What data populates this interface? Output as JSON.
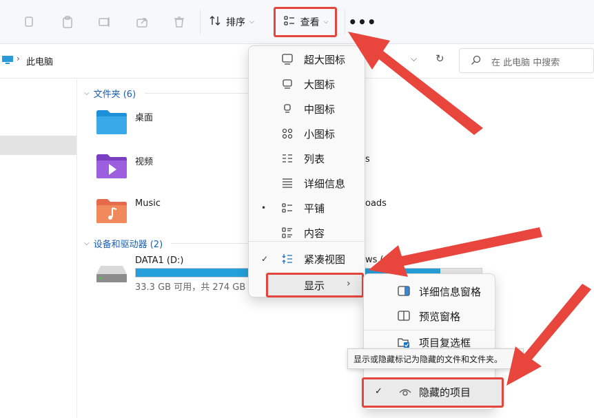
{
  "toolbar": {
    "icons": [
      "copy-icon",
      "paste-icon",
      "rename-icon",
      "share-icon",
      "delete-icon"
    ],
    "sort_label": "排序",
    "view_label": "查看",
    "more_label": "•••"
  },
  "address": {
    "breadcrumb": "此电脑",
    "search_placeholder": "在 此电脑 中搜索"
  },
  "groups": {
    "folders_header": "文件夹 (6)",
    "devices_header": "设备和驱动器 (2)"
  },
  "folders": [
    {
      "label": "桌面"
    },
    {
      "label": "视频"
    },
    {
      "label": "Music"
    }
  ],
  "peek": {
    "p1": "s",
    "p2": "oads",
    "p3": "ws (C"
  },
  "drive": {
    "name": "DATA1 (D:)",
    "info": "33.3 GB 可用，共 274 GB",
    "used_fraction": 0.88
  },
  "view_menu": {
    "items": [
      {
        "label": "超大图标",
        "mark": ""
      },
      {
        "label": "大图标",
        "mark": ""
      },
      {
        "label": "中图标",
        "mark": ""
      },
      {
        "label": "小图标",
        "mark": ""
      },
      {
        "label": "列表",
        "mark": ""
      },
      {
        "label": "详细信息",
        "mark": ""
      },
      {
        "label": "平铺",
        "mark": "•"
      },
      {
        "label": "内容",
        "mark": ""
      },
      {
        "label": "紧凑视图",
        "mark": "✓"
      }
    ],
    "show_label": "显示"
  },
  "show_submenu": {
    "items": [
      {
        "label": "详细信息窗格"
      },
      {
        "label": "预览窗格"
      },
      {
        "label": "项目复选框"
      }
    ],
    "hidden_items_label": "隐藏的项目",
    "hidden_items_mark": "✓"
  },
  "tooltip": "显示或隐藏标记为隐藏的文件和文件夹。",
  "colors": {
    "accent": "#1a5fb4",
    "highlight_border": "#e4453d",
    "arrow": "#e8453c",
    "drive_fill": "#26a0da"
  }
}
